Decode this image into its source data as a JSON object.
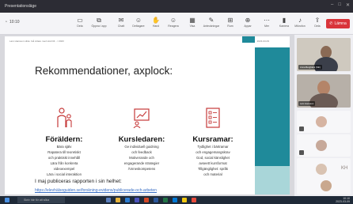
{
  "window": {
    "title": "Presentationsläge"
  },
  "toolbar": {
    "time": "10:10",
    "tools": [
      {
        "label": "Dela",
        "icon": "share-icon"
      },
      {
        "label": "Öppna i app",
        "icon": "open-app-icon"
      },
      {
        "label": "Chatt",
        "icon": "chat-icon"
      },
      {
        "label": "Deltagare",
        "icon": "participants-icon"
      },
      {
        "label": "Hand",
        "icon": "raise-hand-icon"
      },
      {
        "label": "Reagera",
        "icon": "react-icon"
      },
      {
        "label": "Visa",
        "icon": "view-icon"
      },
      {
        "label": "Anteckningar",
        "icon": "notes-icon"
      },
      {
        "label": "Rum",
        "icon": "rooms-icon"
      },
      {
        "label": "Appar",
        "icon": "apps-icon"
      },
      {
        "label": "Mer",
        "icon": "more-icon"
      },
      {
        "label": "Kamera",
        "icon": "camera-icon"
      },
      {
        "label": "Mikrofon",
        "icon": "mic-icon"
      },
      {
        "label": "Dela",
        "icon": "share-screen-icon"
      }
    ],
    "leave": "Lämna"
  },
  "slide": {
    "header_left": "Lars Hansson slide: Gå vidare med stöd till... / 2023",
    "header_right": "2023-03-09",
    "title": "Rekommendationer, axplock:",
    "columns": [
      {
        "heading": "Föräldern:",
        "lines": [
          "Bära själv",
          "Rapatera till teoretiskt",
          "och praktiskt innehåll",
          "Lära från konkreta",
          "videoexempel",
          "Lära i social interaktion"
        ]
      },
      {
        "heading": "Kursledaren:",
        "lines": [
          "Ge individuell guidning",
          "och feedback",
          "Motiverande och",
          "engagerande strategier",
          "Ämneskompetens"
        ]
      },
      {
        "heading": "Kursramar:",
        "lines": [
          "Tydlighet i bärtramar",
          "och engagemangskrav",
          "God, social känslighet",
          "avseett kursformat",
          "Tillgänglighet: språk",
          "och material"
        ]
      }
    ],
    "note": "I maj publiceras rapporten i sin helhet:",
    "link": "https://elevhälsoguiden.se/forskning-evidens/publicerade-och-arbeten"
  },
  "participants": [
    {
      "name": "Anna Bergbäck (Sth)"
    },
    {
      "name": "Lars Hansson"
    }
  ],
  "small_tiles": [
    {
      "initials": ""
    },
    {
      "initials": "KH"
    },
    {
      "initials": ""
    },
    {
      "initials": ""
    }
  ],
  "taskbar": {
    "search": "Skriv här för att söka",
    "time": "10:10",
    "date": "2023-03-09"
  }
}
